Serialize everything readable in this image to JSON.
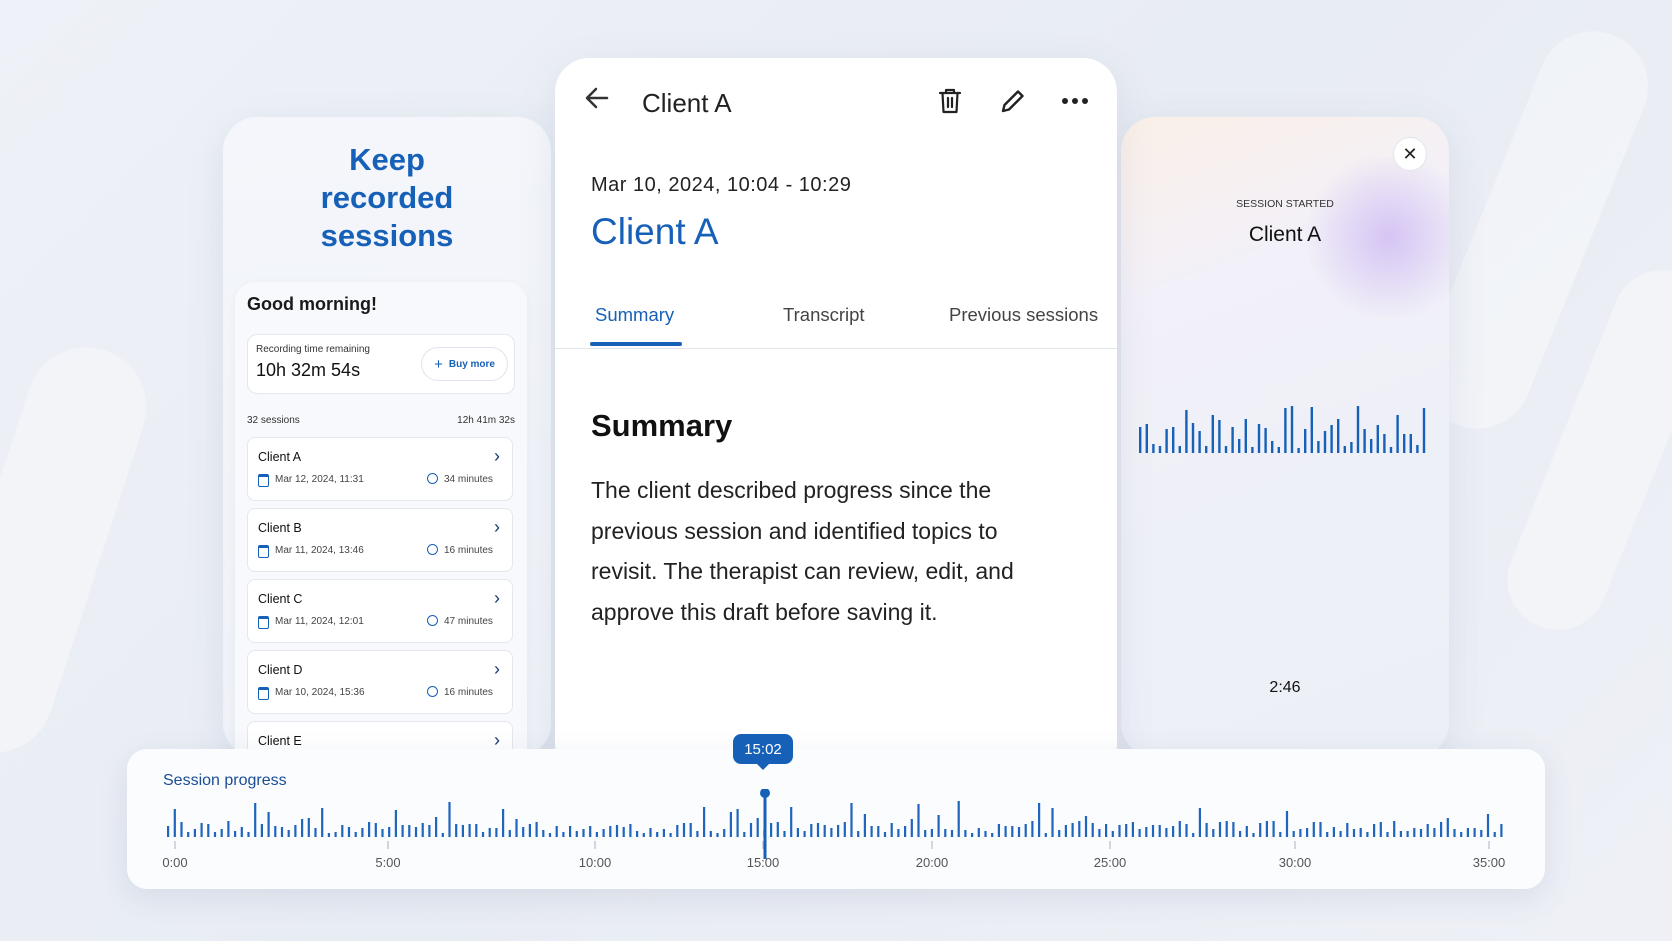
{
  "left_card": {
    "hero_line1": "Keep",
    "hero_line2": "recorded",
    "hero_line3": "sessions",
    "greeting": "Good morning!",
    "recording_label": "Recording time remaining",
    "recording_value": "10h 32m 54s",
    "buy_label": "Buy more",
    "sessions_count": "32 sessions",
    "sessions_total": "12h 41m 32s",
    "sessions": [
      {
        "name": "Client A",
        "date": "Mar 12, 2024, 11:31",
        "duration": "34 minutes"
      },
      {
        "name": "Client B",
        "date": "Mar 11, 2024, 13:46",
        "duration": "16 minutes"
      },
      {
        "name": "Client C",
        "date": "Mar 11, 2024, 12:01",
        "duration": "47 minutes"
      },
      {
        "name": "Client D",
        "date": "Mar 10, 2024, 15:36",
        "duration": "16 minutes"
      },
      {
        "name": "Client E",
        "date": "",
        "duration": ""
      }
    ]
  },
  "center_card": {
    "title": "Client A",
    "datetime": "Mar 10, 2024, 10:04 - 10:29",
    "client_name": "Client A",
    "tabs": [
      "Summary",
      "Transcript",
      "Previous sessions"
    ],
    "active_tab": "Summary",
    "summary_heading": "Summary",
    "summary_text": "The client described progress since the previous session and identified topics to revisit. The therapist can review, edit, and approve this draft before saving it."
  },
  "right_card": {
    "status": "SESSION STARTED",
    "client_name": "Client A",
    "timer": "2:46"
  },
  "progress_bar": {
    "label": "Session progress",
    "current_time": "15:02",
    "ticks": [
      "0:00",
      "5:00",
      "10:00",
      "15:00",
      "20:00",
      "25:00",
      "30:00",
      "35:00"
    ]
  },
  "colors": {
    "accent": "#1760b8",
    "background": "#eef1f7"
  }
}
